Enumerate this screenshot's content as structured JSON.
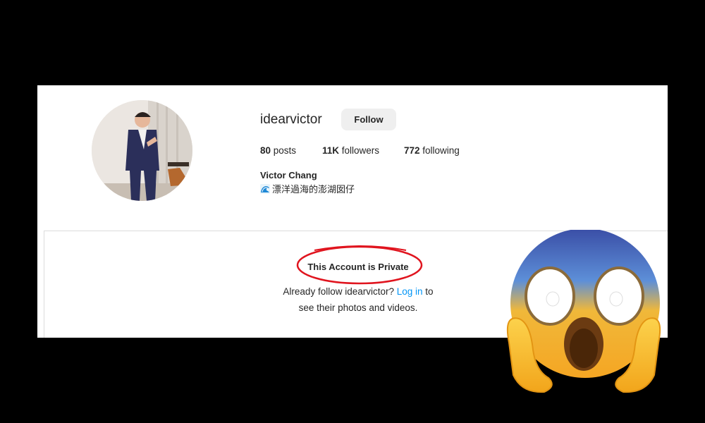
{
  "profile": {
    "username": "idearvictor",
    "follow_label": "Follow",
    "stats": {
      "posts_count": "80",
      "posts_label": " posts",
      "followers_count": "11K",
      "followers_label": " followers",
      "following_count": "772",
      "following_label": " following"
    },
    "full_name": "Victor Chang",
    "bio_text": "漂洋過海的澎湖囡仔",
    "bio_emoji": "wave-icon"
  },
  "private": {
    "title": "This Account is Private",
    "line1_prefix": "Already follow idearvictor? ",
    "login_link": "Log in",
    "line1_suffix": " to",
    "line2": "see their photos and videos."
  },
  "decorations": {
    "annotation_color": "#e0141e",
    "emoji": "face-screaming-in-fear-icon",
    "link_color": "#0095f6"
  }
}
